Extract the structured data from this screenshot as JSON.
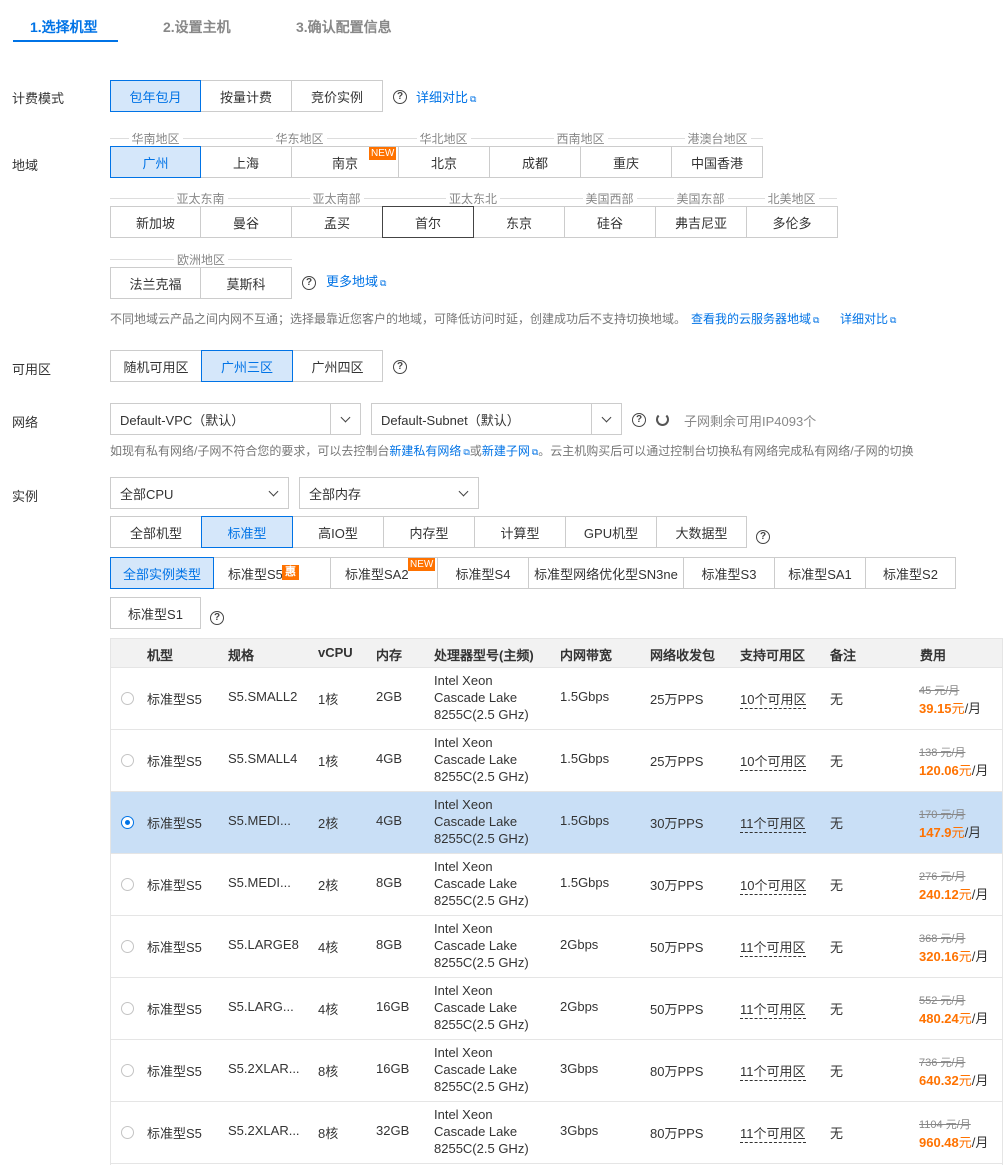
{
  "steps": [
    "1.选择机型",
    "2.设置主机",
    "3.确认配置信息"
  ],
  "billing": {
    "label": "计费模式",
    "options": [
      "包年包月",
      "按量计费",
      "竞价实例"
    ],
    "selected": "包年包月",
    "link": "详细对比"
  },
  "region": {
    "label": "地域",
    "groups": [
      "华南地区",
      "华东地区",
      "华北地区",
      "西南地区",
      "港澳台地区",
      "亚太东南",
      "亚太南部",
      "亚太东北",
      "美国西部",
      "美国东部",
      "北美地区",
      "欧洲地区"
    ],
    "cities": [
      "广州",
      "上海",
      "南京",
      "北京",
      "成都",
      "重庆",
      "中国香港",
      "新加坡",
      "曼谷",
      "孟买",
      "首尔",
      "东京",
      "硅谷",
      "弗吉尼亚",
      "多伦多",
      "法兰克福",
      "莫斯科"
    ],
    "selected": "广州",
    "new_badge": "NEW",
    "more_link": "更多地域",
    "note": "不同地域云产品之间内网不互通；选择最靠近您客户的地域，可降低访问时延，创建成功后不支持切换地域。",
    "note_link1": "查看我的云服务器地域",
    "note_link2": "详细对比"
  },
  "zone": {
    "label": "可用区",
    "options": [
      "随机可用区",
      "广州三区",
      "广州四区"
    ],
    "selected": "广州三区"
  },
  "network": {
    "label": "网络",
    "vpc": "Default-VPC（默认）",
    "subnet": "Default-Subnet（默认）",
    "ip_remaining": "子网剩余可用IP4093个",
    "note_a": "如现有私有网络/子网不符合您的要求，可以去控制台",
    "link_vpc": "新建私有网络",
    "note_or": "或",
    "link_subnet": "新建子网",
    "note_b": "。云主机购买后可以通过控制台切换私有网络完成私有网络/子网的切换"
  },
  "instance": {
    "label": "实例",
    "cpu_filter": "全部CPU",
    "mem_filter": "全部内存",
    "families": [
      "全部机型",
      "标准型",
      "高IO型",
      "内存型",
      "计算型",
      "GPU机型",
      "大数据型"
    ],
    "family_selected": "标准型",
    "types": [
      "全部实例类型",
      "标准型S5",
      "标准型SA2",
      "标准型S4",
      "标准型网络优化型SN3ne",
      "标准型S3",
      "标准型SA1",
      "标准型S2",
      "标准型S1"
    ],
    "type_selected": "全部实例类型",
    "hui_badge": "惠",
    "new_badge": "NEW"
  },
  "table": {
    "headers": [
      "机型",
      "规格",
      "vCPU",
      "内存",
      "处理器型号(主频)",
      "内网带宽",
      "网络收发包",
      "支持可用区",
      "备注",
      "费用"
    ],
    "unit": "元/月",
    "rows": [
      {
        "type": "标准型S5",
        "spec": "S5.SMALL2",
        "vcpu": "1核",
        "mem": "2GB",
        "cpu1": "Intel Xeon",
        "cpu2": "Cascade Lake",
        "cpu3": "8255C(2.5 GHz)",
        "bw": "1.5Gbps",
        "pps": "25万PPS",
        "zones": "10个可用区",
        "remark": "无",
        "old": "45 元/月",
        "price": "39.15",
        "selected": false
      },
      {
        "type": "标准型S5",
        "spec": "S5.SMALL4",
        "vcpu": "1核",
        "mem": "4GB",
        "cpu1": "Intel Xeon",
        "cpu2": "Cascade Lake",
        "cpu3": "8255C(2.5 GHz)",
        "bw": "1.5Gbps",
        "pps": "25万PPS",
        "zones": "10个可用区",
        "remark": "无",
        "old": "138 元/月",
        "price": "120.06",
        "selected": false
      },
      {
        "type": "标准型S5",
        "spec": "S5.MEDI...",
        "vcpu": "2核",
        "mem": "4GB",
        "cpu1": "Intel Xeon",
        "cpu2": "Cascade Lake",
        "cpu3": "8255C(2.5 GHz)",
        "bw": "1.5Gbps",
        "pps": "30万PPS",
        "zones": "11个可用区",
        "remark": "无",
        "old": "170 元/月",
        "price": "147.9",
        "selected": true
      },
      {
        "type": "标准型S5",
        "spec": "S5.MEDI...",
        "vcpu": "2核",
        "mem": "8GB",
        "cpu1": "Intel Xeon",
        "cpu2": "Cascade Lake",
        "cpu3": "8255C(2.5 GHz)",
        "bw": "1.5Gbps",
        "pps": "30万PPS",
        "zones": "10个可用区",
        "remark": "无",
        "old": "276 元/月",
        "price": "240.12",
        "selected": false
      },
      {
        "type": "标准型S5",
        "spec": "S5.LARGE8",
        "vcpu": "4核",
        "mem": "8GB",
        "cpu1": "Intel Xeon",
        "cpu2": "Cascade Lake",
        "cpu3": "8255C(2.5 GHz)",
        "bw": "2Gbps",
        "pps": "50万PPS",
        "zones": "11个可用区",
        "remark": "无",
        "old": "368 元/月",
        "price": "320.16",
        "selected": false
      },
      {
        "type": "标准型S5",
        "spec": "S5.LARG...",
        "vcpu": "4核",
        "mem": "16GB",
        "cpu1": "Intel Xeon",
        "cpu2": "Cascade Lake",
        "cpu3": "8255C(2.5 GHz)",
        "bw": "2Gbps",
        "pps": "50万PPS",
        "zones": "11个可用区",
        "remark": "无",
        "old": "552 元/月",
        "price": "480.24",
        "selected": false
      },
      {
        "type": "标准型S5",
        "spec": "S5.2XLAR...",
        "vcpu": "8核",
        "mem": "16GB",
        "cpu1": "Intel Xeon",
        "cpu2": "Cascade Lake",
        "cpu3": "8255C(2.5 GHz)",
        "bw": "3Gbps",
        "pps": "80万PPS",
        "zones": "11个可用区",
        "remark": "无",
        "old": "736 元/月",
        "price": "640.32",
        "selected": false
      },
      {
        "type": "标准型S5",
        "spec": "S5.2XLAR...",
        "vcpu": "8核",
        "mem": "32GB",
        "cpu1": "Intel Xeon",
        "cpu2": "Cascade Lake",
        "cpu3": "8255C(2.5 GHz)",
        "bw": "3Gbps",
        "pps": "80万PPS",
        "zones": "11个可用区",
        "remark": "无",
        "old": "1104 元/月",
        "price": "960.48",
        "selected": false
      }
    ]
  }
}
